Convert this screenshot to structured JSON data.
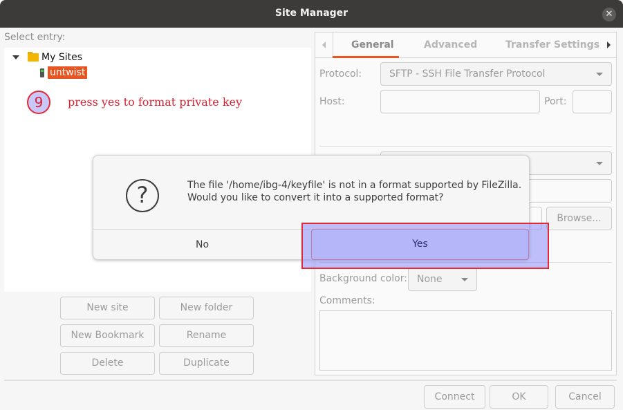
{
  "window": {
    "title": "Site Manager",
    "close_icon": "close-icon"
  },
  "left": {
    "select_label": "Select entry:",
    "tree": {
      "root": {
        "label": "My Sites",
        "icon": "folder-icon",
        "expanded": true
      },
      "children": [
        {
          "label": "untwist",
          "icon": "server-icon",
          "selected": true
        }
      ]
    },
    "buttons": {
      "new_site": "New site",
      "new_folder": "New folder",
      "new_bookmark": "New Bookmark",
      "rename": "Rename",
      "delete": "Delete",
      "duplicate": "Duplicate"
    }
  },
  "annotation": {
    "step": "9",
    "text": "press yes to format  private key",
    "color": "#d92030"
  },
  "tabs": [
    {
      "label": "General",
      "active": true
    },
    {
      "label": "Advanced",
      "active": false
    },
    {
      "label": "Transfer Settings",
      "active": false
    }
  ],
  "general": {
    "protocol_label": "Protocol:",
    "protocol_value": "SFTP - SSH File Transfer Protocol",
    "host_label": "Host:",
    "host_value": "",
    "port_label": "Port:",
    "port_value": "",
    "browse_label": "Browse...",
    "bg_color_label": "Background color:",
    "bg_color_value": "None",
    "comments_label": "Comments:",
    "comments_value": ""
  },
  "dialog": {
    "icon": "question-icon",
    "line1": "The file '/home/ibg-4/keyfile' is not in a format supported by FileZilla.",
    "line2": "Would you like to convert it into a supported format?",
    "no_label": "No",
    "yes_label": "Yes"
  },
  "footer": {
    "connect": "Connect",
    "ok": "OK",
    "cancel": "Cancel"
  },
  "colors": {
    "accent": "#e95420",
    "titlebar": "#3d3b39",
    "highlight": "#e02a36"
  }
}
